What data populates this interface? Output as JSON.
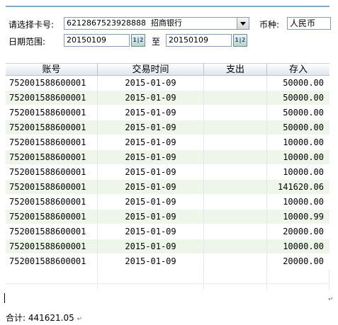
{
  "filter": {
    "card_label": "请选择卡号:",
    "card_number": "6212867523928888",
    "bank_name": "招商银行",
    "currency_label": "币种:",
    "currency_value": "人民币",
    "date_label": "日期范围:",
    "date_from": "20150109",
    "date_to": "20150109",
    "to_label": "至",
    "calendar_icon_text": "1|2"
  },
  "grid": {
    "columns": [
      "账号",
      "交易时间",
      "支出",
      "存入"
    ],
    "rows": [
      {
        "account": "752001588600001",
        "time": "2015-01-09",
        "out": "",
        "in": "50000.00"
      },
      {
        "account": "752001588600001",
        "time": "2015-01-09",
        "out": "",
        "in": "50000.00"
      },
      {
        "account": "752001588600001",
        "time": "2015-01-09",
        "out": "",
        "in": "50000.00"
      },
      {
        "account": "752001588600001",
        "time": "2015-01-09",
        "out": "",
        "in": "50000.00"
      },
      {
        "account": "752001588600001",
        "time": "2015-01-09",
        "out": "",
        "in": "10000.00"
      },
      {
        "account": "752001588600001",
        "time": "2015-01-09",
        "out": "",
        "in": "10000.00"
      },
      {
        "account": "752001588600001",
        "time": "2015-01-09",
        "out": "",
        "in": "10000.00"
      },
      {
        "account": "752001588600001",
        "time": "2015-01-09",
        "out": "",
        "in": "141620.06"
      },
      {
        "account": "752001588600001",
        "time": "2015-01-09",
        "out": "",
        "in": "10000.00"
      },
      {
        "account": "752001588600001",
        "time": "2015-01-09",
        "out": "",
        "in": "10000.99"
      },
      {
        "account": "752001588600001",
        "time": "2015-01-09",
        "out": "",
        "in": "20000.00"
      },
      {
        "account": "752001588600001",
        "time": "2015-01-09",
        "out": "",
        "in": "10000.00"
      },
      {
        "account": "752001588600001",
        "time": "2015-01-09",
        "out": "",
        "in": "20000.00"
      }
    ]
  },
  "footer": {
    "total_label": "合计:",
    "total_value": "441621.05",
    "paragraph_mark": "↵"
  },
  "colors": {
    "accent_border": "#7ea9c8",
    "row_alt": "#edf6e8"
  }
}
